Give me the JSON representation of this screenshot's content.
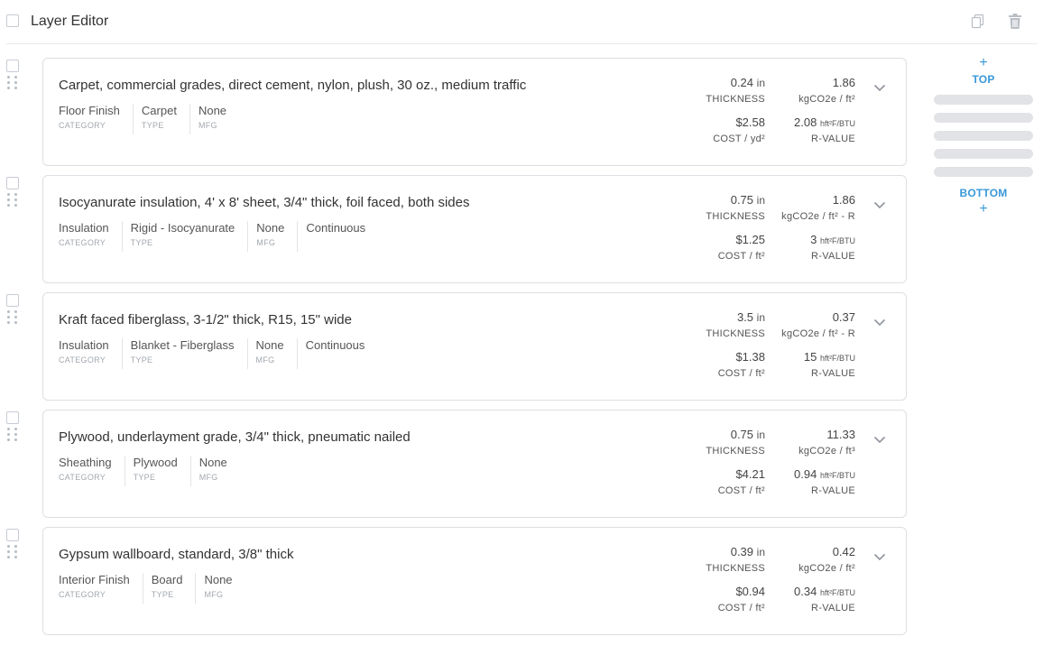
{
  "header": {
    "title": "Layer Editor",
    "copy_icon": "copy-icon",
    "delete_icon": "trash-icon"
  },
  "layers": [
    {
      "name": "Carpet, commercial grades, direct cement, nylon, plush, 30 oz., medium traffic",
      "meta": [
        {
          "value": "Floor Finish",
          "label": "CATEGORY"
        },
        {
          "value": "Carpet",
          "label": "TYPE"
        },
        {
          "value": "None",
          "label": "MFG"
        }
      ],
      "thickness": "0.24",
      "thickness_unit": "in",
      "thickness_label": "THICKNESS",
      "gwp": "1.86",
      "gwp_label": "kgCO2e / ft²",
      "cost": "$2.58",
      "cost_label": "COST / yd²",
      "rvalue": "2.08",
      "rvalue_unit": "hft²F/BTU",
      "rvalue_label": "R-VALUE"
    },
    {
      "name": "Isocyanurate insulation, 4' x 8' sheet, 3/4\" thick, foil faced, both sides",
      "meta": [
        {
          "value": "Insulation",
          "label": "CATEGORY"
        },
        {
          "value": "Rigid - Isocyanurate",
          "label": "TYPE"
        },
        {
          "value": "None",
          "label": "MFG"
        },
        {
          "value": "Continuous",
          "label": ""
        }
      ],
      "thickness": "0.75",
      "thickness_unit": "in",
      "thickness_label": "THICKNESS",
      "gwp": "1.86",
      "gwp_label": "kgCO2e / ft² - R",
      "cost": "$1.25",
      "cost_label": "COST / ft²",
      "rvalue": "3",
      "rvalue_unit": "hft²F/BTU",
      "rvalue_label": "R-VALUE"
    },
    {
      "name": "Kraft faced fiberglass, 3-1/2\" thick, R15, 15\" wide",
      "meta": [
        {
          "value": "Insulation",
          "label": "CATEGORY"
        },
        {
          "value": "Blanket - Fiberglass",
          "label": "TYPE"
        },
        {
          "value": "None",
          "label": "MFG"
        },
        {
          "value": "Continuous",
          "label": ""
        }
      ],
      "thickness": "3.5",
      "thickness_unit": "in",
      "thickness_label": "THICKNESS",
      "gwp": "0.37",
      "gwp_label": "kgCO2e / ft² - R",
      "cost": "$1.38",
      "cost_label": "COST / ft²",
      "rvalue": "15",
      "rvalue_unit": "hft²F/BTU",
      "rvalue_label": "R-VALUE"
    },
    {
      "name": "Plywood, underlayment grade, 3/4\" thick, pneumatic nailed",
      "meta": [
        {
          "value": "Sheathing",
          "label": "CATEGORY"
        },
        {
          "value": "Plywood",
          "label": "TYPE"
        },
        {
          "value": "None",
          "label": "MFG"
        }
      ],
      "thickness": "0.75",
      "thickness_unit": "in",
      "thickness_label": "THICKNESS",
      "gwp": "11.33",
      "gwp_label": "kgCO2e / ft³",
      "cost": "$4.21",
      "cost_label": "COST / ft²",
      "rvalue": "0.94",
      "rvalue_unit": "hft²F/BTU",
      "rvalue_label": "R-VALUE"
    },
    {
      "name": "Gypsum wallboard, standard, 3/8\" thick",
      "meta": [
        {
          "value": "Interior Finish",
          "label": "CATEGORY"
        },
        {
          "value": "Board",
          "label": "TYPE"
        },
        {
          "value": "None",
          "label": "MFG"
        }
      ],
      "thickness": "0.39",
      "thickness_unit": "in",
      "thickness_label": "THICKNESS",
      "gwp": "0.42",
      "gwp_label": "kgCO2e / ft²",
      "cost": "$0.94",
      "cost_label": "COST / ft²",
      "rvalue": "0.34",
      "rvalue_unit": "hft²F/BTU",
      "rvalue_label": "R-VALUE"
    }
  ],
  "position_panel": {
    "top_plus": "+",
    "top_label": "TOP",
    "bottom_label": "BOTTOM",
    "bottom_plus": "+"
  },
  "colors": {
    "accent": "#3a98d8",
    "border": "#dcdfe3",
    "placeholder_bar": "#e1e3e6"
  }
}
